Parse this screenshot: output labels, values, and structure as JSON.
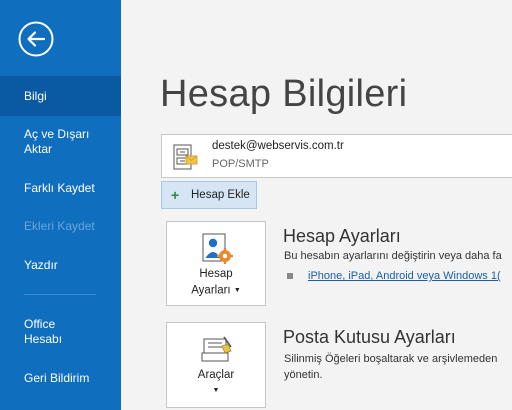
{
  "sidebar": {
    "items": [
      {
        "label": "Bilgi"
      },
      {
        "label_line1": "Aç ve Dışarı",
        "label_line2": "Aktar"
      },
      {
        "label": "Farklı Kaydet"
      },
      {
        "label": "Ekleri Kaydet"
      },
      {
        "label": "Yazdır"
      },
      {
        "label_line1": "Office",
        "label_line2": "Hesabı"
      },
      {
        "label": "Geri Bildirim"
      }
    ]
  },
  "main": {
    "title": "Hesap Bilgileri",
    "account": {
      "email": "destek@webservis.com.tr",
      "type": "POP/SMTP"
    },
    "add_account_label": "Hesap Ekle",
    "account_settings": {
      "tile_line1": "Hesap",
      "tile_line2": "Ayarları",
      "title": "Hesap Ayarları",
      "description": "Bu hesabın ayarlarını değiştirin veya daha fa",
      "link": "iPhone, iPad, Android veya Windows 1("
    },
    "mailbox_settings": {
      "tile_label": "Araçlar",
      "title": "Posta Kutusu Ayarları",
      "description_line1": "Silinmiş Öğeleri boşaltarak ve arşivlemeden",
      "description_line2": "yönetin."
    }
  },
  "colors": {
    "sidebar": "#106ebe",
    "sidebar_active": "#0a5aa3",
    "link": "#1a5fa8",
    "add_button_bg": "#d5e5f4"
  }
}
